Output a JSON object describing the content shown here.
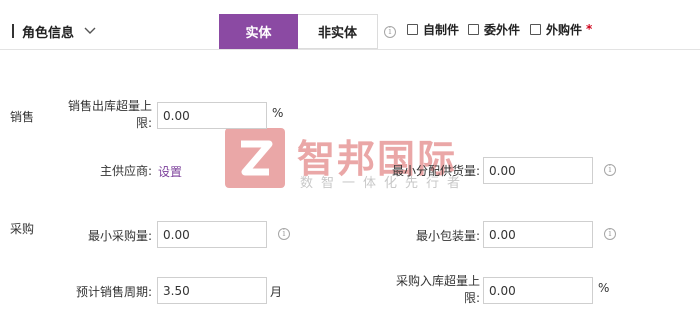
{
  "header": {
    "role_label": "角色信息",
    "tabs": [
      {
        "label": "实体",
        "active": true
      },
      {
        "label": "非实体",
        "active": false
      }
    ],
    "checkboxes": [
      {
        "label": "自制件",
        "checked": false
      },
      {
        "label": "委外件",
        "checked": false
      },
      {
        "label": "外购件",
        "checked": false
      }
    ],
    "required_mark": "*"
  },
  "sales": {
    "section_label": "销售",
    "over_shipment_label_1": "销售出库超量上",
    "over_shipment_label_2": "限:",
    "over_shipment_value": "0.00",
    "over_shipment_unit": "%"
  },
  "supplier": {
    "main_supplier_label": "主供应商:",
    "main_supplier_link": "设置",
    "min_alloc_label": "最小分配供货量:",
    "min_alloc_value": "0.00"
  },
  "purchase": {
    "section_label": "采购",
    "min_purchase_label": "最小采购量:",
    "min_purchase_value": "0.00",
    "min_package_label": "最小包装量:",
    "min_package_value": "0.00",
    "sales_period_label": "预计销售周期:",
    "sales_period_value": "3.50",
    "sales_period_unit": "月",
    "over_receipt_label_1": "采购入库超量上",
    "over_receipt_label_2": "限:",
    "over_receipt_value": "0.00",
    "over_receipt_unit": "%"
  },
  "watermark": {
    "brand": "智邦国际",
    "slogan": "数智一体化先行者",
    "color": "#e48a8a"
  },
  "colors": {
    "accent": "#8b4aa3",
    "link": "#7b3f9a",
    "required": "#d0021b"
  }
}
